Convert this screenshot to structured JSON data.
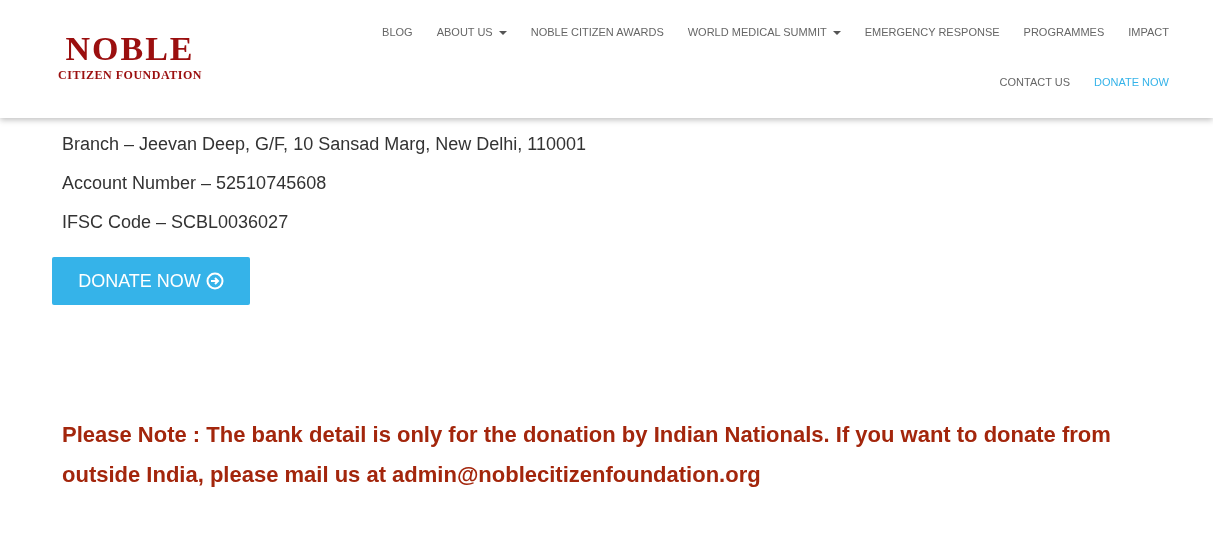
{
  "logo": {
    "title": "NOBLE",
    "subtitle": "CITIZEN FOUNDATION"
  },
  "nav": [
    {
      "label": "BLOG",
      "dropdown": false,
      "selected": false
    },
    {
      "label": "ABOUT US",
      "dropdown": true,
      "selected": false
    },
    {
      "label": "NOBLE CITIZEN AWARDS",
      "dropdown": false,
      "selected": false
    },
    {
      "label": "WORLD MEDICAL SUMMIT",
      "dropdown": true,
      "selected": false
    },
    {
      "label": "EMERGENCY RESPONSE",
      "dropdown": false,
      "selected": false
    },
    {
      "label": "PROGRAMMES",
      "dropdown": false,
      "selected": false
    },
    {
      "label": "IMPACT",
      "dropdown": false,
      "selected": false
    },
    {
      "label": "CONTACT US",
      "dropdown": false,
      "selected": false
    },
    {
      "label": "DONATE NOW",
      "dropdown": false,
      "selected": true
    }
  ],
  "bank_details": [
    "Branch – Jeevan Deep, G/F, 10 Sansad Marg, New Delhi, 110001",
    "Account Number – 52510745608",
    "IFSC Code – SCBL0036027"
  ],
  "donate_button": "DONATE NOW",
  "note": "Please Note : The bank detail is only for the donation by Indian Nationals. If you want to donate from outside India, please mail us at admin@noblecitizenfoundation.org"
}
